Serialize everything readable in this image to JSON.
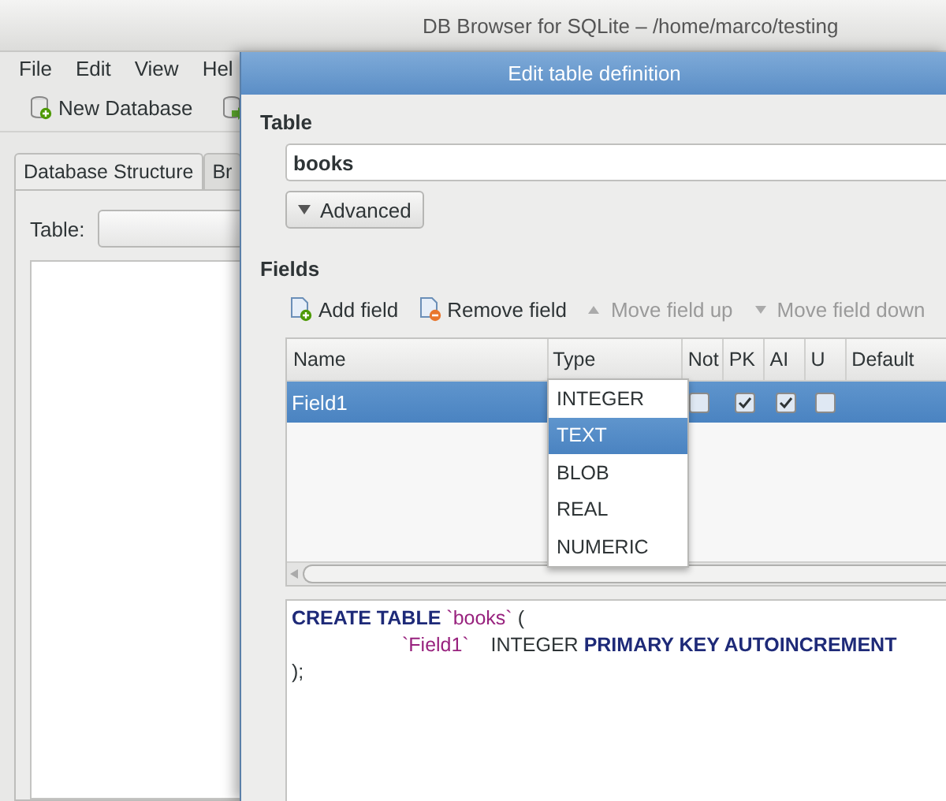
{
  "main_window": {
    "title": "DB Browser for SQLite – /home/marco/testing",
    "menu": [
      "File",
      "Edit",
      "View",
      "Hel"
    ],
    "toolbar": [
      {
        "label": "New Database",
        "kind": "new"
      },
      {
        "kind": "open"
      }
    ],
    "tabs": [
      {
        "label": "Database Structure",
        "selected": true
      },
      {
        "label": "Br",
        "selected": false
      }
    ],
    "table_label": "Table:"
  },
  "dialog": {
    "title": "Edit table definition",
    "table_section": "Table",
    "table_name": "books",
    "advanced_button": "Advanced",
    "fields_section": "Fields",
    "field_tools": [
      {
        "label": "Add field",
        "kind": "add",
        "disabled": false
      },
      {
        "label": "Remove field",
        "kind": "remove",
        "disabled": false
      },
      {
        "label": "Move field up",
        "kind": "up",
        "disabled": true
      },
      {
        "label": "Move field down",
        "kind": "down",
        "disabled": true
      }
    ],
    "columns": [
      "Name",
      "Type",
      "Not",
      "PK",
      "AI",
      "U",
      "Default"
    ],
    "rows": [
      {
        "name": "Field1",
        "selected": true,
        "not_null": false,
        "pk": true,
        "ai": true,
        "unique": false
      }
    ],
    "type_dropdown": [
      {
        "label": "INTEGER",
        "selected": false
      },
      {
        "label": "TEXT",
        "selected": true
      },
      {
        "label": "BLOB",
        "selected": false
      },
      {
        "label": "REAL",
        "selected": false
      },
      {
        "label": "NUMERIC",
        "selected": false
      }
    ],
    "sql": [
      {
        "indent": false,
        "tokens": [
          {
            "text": "CREATE TABLE ",
            "kind": "keyword"
          },
          {
            "text": "`books`",
            "kind": "identifier"
          },
          {
            "text": " (",
            "kind": "plain"
          }
        ]
      },
      {
        "indent": true,
        "tokens": [
          {
            "text": "`Field1`",
            "kind": "identifier"
          },
          {
            "text": "    INTEGER ",
            "kind": "plain"
          },
          {
            "text": "PRIMARY KEY AUTOINCREMENT",
            "kind": "keyword"
          }
        ]
      },
      {
        "indent": false,
        "tokens": [
          {
            "text": ");",
            "kind": "plain"
          }
        ]
      }
    ]
  }
}
